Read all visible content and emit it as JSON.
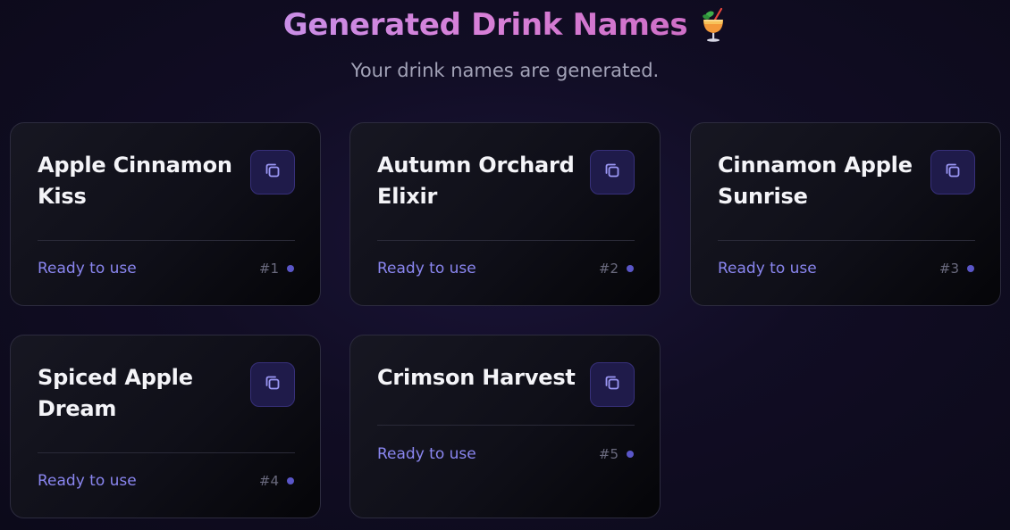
{
  "header": {
    "title": "Generated Drink Names",
    "title_icon": "tropical-drink-icon",
    "subtitle": "Your drink names are generated."
  },
  "colors": {
    "title_gradient_start": "#c98ee6",
    "title_gradient_end": "#cf6fc8",
    "status_text": "#8a86f0",
    "status_dot": "#5a56c8",
    "copy_button_bg": "#1f1b4a"
  },
  "cards": [
    {
      "name": "Apple Cinnamon Kiss",
      "status": "Ready to use",
      "index": "#1"
    },
    {
      "name": "Autumn Orchard Elixir",
      "status": "Ready to use",
      "index": "#2"
    },
    {
      "name": "Cinnamon Apple Sunrise",
      "status": "Ready to use",
      "index": "#3"
    },
    {
      "name": "Spiced Apple Dream",
      "status": "Ready to use",
      "index": "#4"
    },
    {
      "name": "Crimson Harvest",
      "status": "Ready to use",
      "index": "#5"
    }
  ]
}
